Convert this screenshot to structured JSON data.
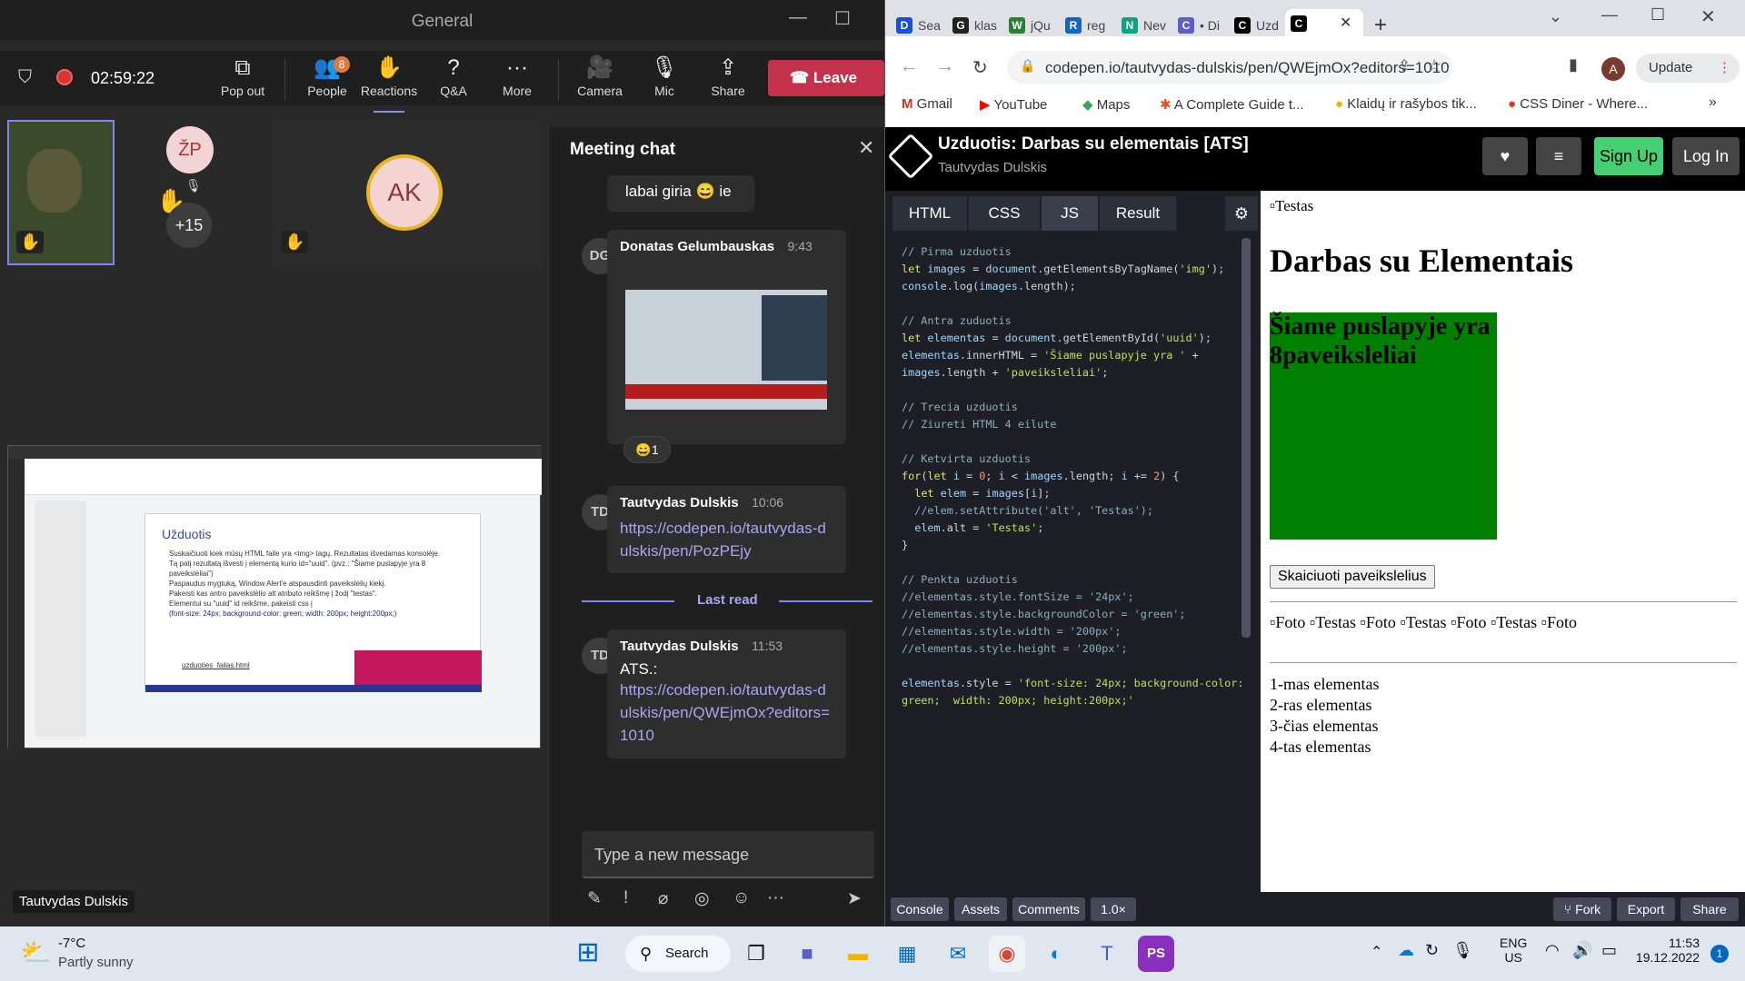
{
  "teams": {
    "window_title": "General",
    "timer": "02:59:22",
    "controls": {
      "pop_out": "Pop out",
      "people": "People",
      "people_badge": "8",
      "reactions": "Reactions",
      "qa": "Q&A",
      "more": "More",
      "camera": "Camera",
      "mic": "Mic",
      "share": "Share",
      "leave": "Leave"
    },
    "participants": {
      "zp": "ŽP",
      "overflow": "+15",
      "ak": "AK"
    },
    "presenter_name": "Tautvydas Dulskis",
    "shared_slide": {
      "title": "Užduotis",
      "bullets": [
        "Suskaičiuoti kiek mūsų HTML faile yra <img> tagų. Rezultatas išvedamas konsolėje.",
        "Tą patį rezultatą išvesti į elementą kurio id=\"uuid\". (pvz.: \"Šiame puslapyje yra 8 paveikslėliai\")",
        "Paspaudus mygtuką, Window Alert'e atspausdinti paveikslėlių kiekį.",
        "Pakeisti kas antro paveikslėlio alt atributo reikšmę į žodį \"testas\".",
        "Elementui su \"uuid\" id reikšme, pakeisti css į",
        "(font-size: 24px; background-color: green; width: 200px; height:200px;)"
      ],
      "file": "uzduoties_failas.html"
    },
    "chat": {
      "title": "Meeting chat",
      "first_msg": "labai giria",
      "first_msg_tail": "ie",
      "messages": [
        {
          "initials": "DG",
          "author": "Donatas Gelumbauskas",
          "time": "9:43",
          "reaction_count": "1"
        },
        {
          "initials": "TD",
          "author": "Tautvydas Dulskis",
          "time": "10:06",
          "link": "https://codepen.io/tautvydas-dulskis/pen/PozPEjy"
        },
        {
          "initials": "TD",
          "author": "Tautvydas Dulskis",
          "time": "11:53",
          "prefix": "ATS.:",
          "link": "https://codepen.io/tautvydas-dulskis/pen/QWEjmOx?editors=1010"
        }
      ],
      "last_read": "Last read",
      "input_placeholder": "Type a new message"
    }
  },
  "browser": {
    "tabs": [
      {
        "label": "Sea",
        "icon": "D"
      },
      {
        "label": "klas",
        "icon": "G"
      },
      {
        "label": "jQu",
        "icon": "W"
      },
      {
        "label": "reg",
        "icon": "R"
      },
      {
        "label": "Nev",
        "icon": "N"
      },
      {
        "label": "• Di",
        "icon": "C"
      },
      {
        "label": "Uzd",
        "icon": "C"
      },
      {
        "label": "",
        "icon": "C"
      }
    ],
    "url": "codepen.io/tautvydas-dulskis/pen/QWEjmOx?editors=1010",
    "profile_initial": "A",
    "update_label": "Update",
    "bookmarks": [
      "Gmail",
      "YouTube",
      "Maps",
      "A Complete Guide t...",
      "Klaidų ir rašybos tik...",
      "CSS Diner - Where..."
    ],
    "codepen": {
      "title": "Uzduotis: Darbas su elementais [ATS]",
      "author": "Tautvydas Dulskis",
      "signup": "Sign Up",
      "login": "Log In",
      "editor_tabs": [
        "HTML",
        "CSS",
        "JS",
        "Result"
      ],
      "footer": [
        "Console",
        "Assets",
        "Comments",
        "1.0×"
      ],
      "footer_right": [
        "Fork",
        "Export",
        "Share"
      ],
      "result": {
        "img_alt_first": "Testas",
        "heading": "Darbas su Elementais",
        "green_box": "Šiame puslapyje yra 8paveiksleliai",
        "button": "Skaiciuoti paveikslelius",
        "img_row": [
          "Foto",
          "Testas",
          "Foto",
          "Testas",
          "Foto",
          "Testas",
          "Foto"
        ],
        "list": [
          "1-mas elementas",
          "2-ras elementas",
          "3-čias elementas",
          "4-tas elementas"
        ]
      }
    }
  },
  "taskbar": {
    "temp": "-7°C",
    "weather": "Partly sunny",
    "search": "Search",
    "lang1": "ENG",
    "lang2": "US",
    "time": "11:53",
    "date": "19.12.2022",
    "notif": "1"
  }
}
